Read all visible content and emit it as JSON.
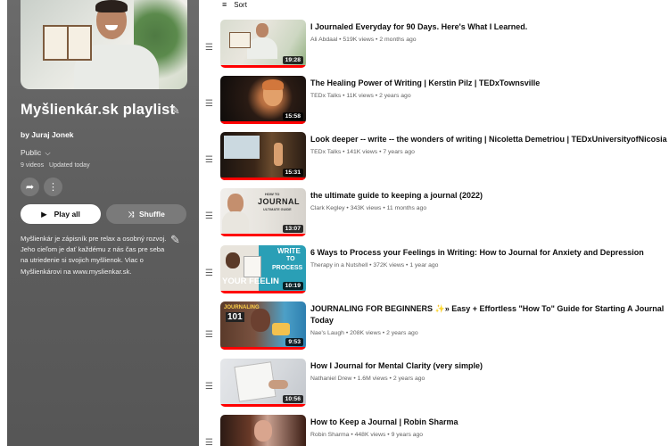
{
  "playlist": {
    "title": "Myšlienkár.sk playlist",
    "owner": "by Juraj Jonek",
    "privacy": "Public",
    "video_count": "9 videos",
    "updated": "Updated today",
    "play_all_label": "Play all",
    "shuffle_label": "Shuffle",
    "description": "Myšlienkár je zápisník pre relax a osobný rozvoj. Jeho cieľom je dať každému z nás čas pre seba na utriedenie si svojich myšlienok. Viac o Myšlienkárovi na www.myslienkar.sk."
  },
  "sort_label": "Sort",
  "videos": [
    {
      "title": "I Journaled Everyday for 90 Days. Here's What I Learned.",
      "channel": "Ali Abdaal",
      "views": "519K views",
      "age": "2 months ago",
      "duration": "19:28"
    },
    {
      "title": "The Healing Power of Writing | Kerstin Pilz | TEDxTownsville",
      "channel": "TEDx Talks",
      "views": "11K views",
      "age": "2 years ago",
      "duration": "15:58"
    },
    {
      "title": "Look deeper -- write -- the wonders of writing | Nicoletta Demetriou | TEDxUniversityofNicosia",
      "channel": "TEDx Talks",
      "views": "141K views",
      "age": "7 years ago",
      "duration": "15:31"
    },
    {
      "title": "the ultimate guide to keeping a journal (2022)",
      "channel": "Clark Kegley",
      "views": "343K views",
      "age": "11 months ago",
      "duration": "13:07"
    },
    {
      "title": "6 Ways to Process your Feelings in Writing: How to Journal for Anxiety and Depression",
      "channel": "Therapy in a Nutshell",
      "views": "372K views",
      "age": "1 year ago",
      "duration": "10:19"
    },
    {
      "title": "JOURNALING FOR BEGINNERS ✨» Easy + Effortless \"How To\" Guide for Starting A Journal Today",
      "channel": "Nae's Laugh",
      "views": "208K views",
      "age": "2 years ago",
      "duration": "9:53"
    },
    {
      "title": "How I Journal for Mental Clarity (very simple)",
      "channel": "Nathaniel Drew",
      "views": "1.6M views",
      "age": "2 years ago",
      "duration": "10:56"
    },
    {
      "title": "How to Keep a Journal | Robin Sharma",
      "channel": "Robin Sharma",
      "views": "448K views",
      "age": "9 years ago",
      "duration": ""
    }
  ],
  "thumb_text": {
    "clark_small": "HOW TO",
    "clark_big": "JOURNAL",
    "clark_sub": "ULTIMATE GUIDE",
    "therapy_1": "WRITE",
    "therapy_2": "TO",
    "therapy_3": "PROCESS",
    "therapy_4": "YOUR FEELIN",
    "nae_1": "JOURNALING",
    "nae_2": "101"
  },
  "icons": {
    "edit": "pencil-icon",
    "chevron": "chevron-down-icon",
    "share": "share-icon",
    "more": "more-vert-icon",
    "play": "play-icon",
    "shuffle": "shuffle-icon",
    "sort": "sort-icon",
    "drag": "drag-handle-icon"
  },
  "colors": {
    "progress": "#ff0000",
    "panel": "#616161"
  }
}
